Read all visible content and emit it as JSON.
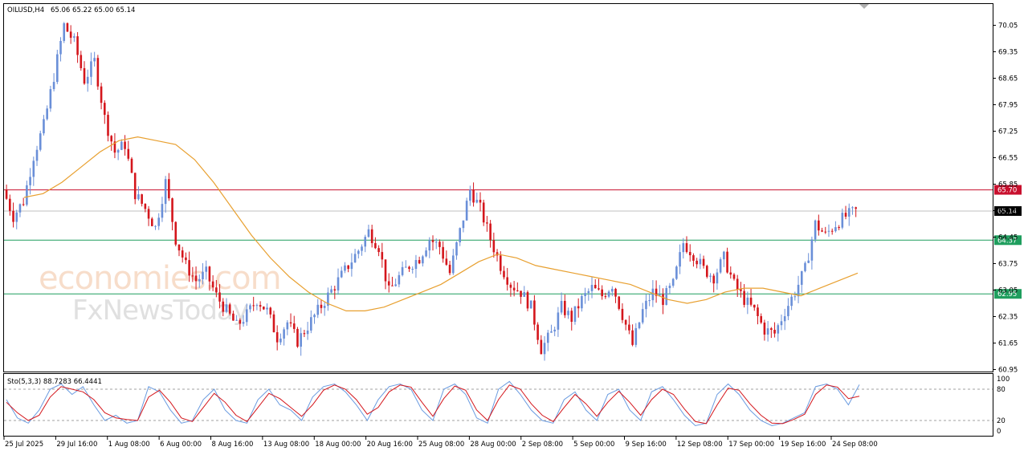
{
  "header": {
    "symbol": "OILUSD,H4",
    "ohlc": "65.06 65.22 65.00 65.14"
  },
  "stoch_header": {
    "label": "Sto(5,3,3) 88.7283 66.4441"
  },
  "watermark": {
    "line1": "economies.com",
    "line2": "FxNewsToday"
  },
  "colors": {
    "bull": "#6a8fd8",
    "bear": "#d4161c",
    "ma": "#e8a030",
    "resistance": "#c8102e",
    "support": "#1f9e5e",
    "current": "#000000",
    "stoch_main": "#6a9be0",
    "stoch_signal": "#d4161c"
  },
  "chart_data": [
    {
      "type": "candlestick",
      "symbol": "OILUSD",
      "timeframe": "H4",
      "title": "OILUSD,H4",
      "ylim": [
        60.95,
        70.4
      ],
      "y_ticks": [
        "70.05",
        "69.35",
        "68.65",
        "67.95",
        "67.25",
        "66.55",
        "65.85",
        "65.15",
        "64.45",
        "63.75",
        "63.05",
        "62.35",
        "61.65",
        "60.95"
      ],
      "x_ticks": [
        "25 Jul 2025",
        "29 Jul 16:00",
        "1 Aug 08:00",
        "6 Aug 00:00",
        "8 Aug 16:00",
        "13 Aug 08:00",
        "18 Aug 00:00",
        "20 Aug 16:00",
        "25 Aug 08:00",
        "28 Aug 00:00",
        "2 Sep 08:00",
        "5 Sep 00:00",
        "9 Sep 16:00",
        "12 Sep 08:00",
        "17 Sep 00:00",
        "19 Sep 16:00",
        "24 Sep 08:00"
      ],
      "price_path": [
        65.7,
        65.0,
        65.4,
        66.6,
        67.4,
        68.7,
        70.05,
        69.6,
        68.6,
        69.1,
        67.6,
        66.7,
        66.9,
        65.6,
        65.2,
        64.7,
        65.9,
        64.4,
        63.7,
        63.3,
        63.5,
        62.9,
        62.5,
        62.1,
        62.4,
        62.8,
        62.5,
        61.8,
        62.2,
        61.7,
        62.1,
        62.5,
        62.9,
        63.3,
        63.7,
        64.1,
        64.6,
        64.2,
        63.0,
        63.4,
        63.7,
        63.9,
        64.4,
        64.2,
        63.5,
        64.6,
        65.7,
        65.2,
        64.4,
        63.7,
        63.2,
        63.0,
        62.6,
        61.5,
        61.9,
        62.6,
        62.3,
        62.8,
        63.1,
        62.9,
        63.2,
        62.4,
        61.6,
        62.5,
        63.0,
        62.8,
        63.2,
        64.3,
        64.0,
        63.6,
        63.4,
        63.9,
        63.2,
        62.8,
        62.5,
        62.0,
        61.9,
        62.5,
        63.0,
        63.6,
        64.8,
        64.5,
        64.8,
        65.0,
        65.14
      ],
      "bearish_index": [
        1,
        6,
        8,
        10,
        12,
        15,
        17,
        20,
        22,
        25,
        26,
        28,
        36,
        37,
        42,
        43,
        46,
        47,
        48,
        49,
        50,
        51,
        52,
        55,
        60,
        61,
        64,
        67,
        68,
        69,
        71,
        72,
        73,
        74,
        75,
        80
      ],
      "series": [
        {
          "name": "",
          "kind": "moving_average",
          "values": [
            65.5,
            65.6,
            65.9,
            66.3,
            66.7,
            67.0,
            67.1,
            67.0,
            66.9,
            66.5,
            65.9,
            65.2,
            64.5,
            63.9,
            63.4,
            63.0,
            62.7,
            62.5,
            62.5,
            62.6,
            62.8,
            63.0,
            63.2,
            63.5,
            63.8,
            64.0,
            63.9,
            63.7,
            63.6,
            63.5,
            63.4,
            63.3,
            63.2,
            63.0,
            62.8,
            62.7,
            62.8,
            63.0,
            63.1,
            63.1,
            63.0,
            62.9,
            63.1,
            63.3,
            63.5
          ]
        }
      ],
      "levels": [
        {
          "label": "65.70",
          "value": 65.7,
          "kind": "resistance"
        },
        {
          "label": "65.14",
          "value": 65.14,
          "kind": "current"
        },
        {
          "label": "64.37",
          "value": 64.37,
          "kind": "support"
        },
        {
          "label": "62.95",
          "value": 62.95,
          "kind": "support"
        }
      ]
    },
    {
      "type": "line",
      "title": "Sto(5,3,3) 88.7283 66.4441",
      "ylim": [
        0,
        100
      ],
      "y_ticks": [
        "100",
        "80",
        "20",
        "0"
      ],
      "reference_lines": [
        80,
        20
      ],
      "series": [
        {
          "name": "",
          "kind": "main",
          "values": [
            60,
            25,
            15,
            40,
            80,
            90,
            70,
            85,
            50,
            20,
            30,
            15,
            20,
            85,
            75,
            40,
            15,
            20,
            60,
            80,
            40,
            20,
            15,
            60,
            80,
            50,
            40,
            20,
            65,
            85,
            90,
            75,
            50,
            20,
            60,
            85,
            90,
            80,
            40,
            20,
            80,
            90,
            70,
            25,
            15,
            80,
            95,
            70,
            40,
            20,
            15,
            60,
            75,
            40,
            20,
            70,
            80,
            40,
            20,
            75,
            85,
            60,
            30,
            10,
            15,
            70,
            90,
            70,
            40,
            20,
            10,
            15,
            25,
            35,
            85,
            90,
            80,
            50,
            88.7283
          ]
        },
        {
          "name": "",
          "kind": "signal",
          "values": [
            55,
            35,
            20,
            30,
            65,
            85,
            80,
            75,
            60,
            35,
            25,
            22,
            20,
            65,
            78,
            55,
            25,
            18,
            45,
            72,
            55,
            30,
            18,
            45,
            72,
            62,
            45,
            28,
            50,
            78,
            88,
            80,
            60,
            32,
            45,
            75,
            88,
            84,
            55,
            28,
            62,
            86,
            78,
            40,
            20,
            60,
            88,
            80,
            52,
            30,
            18,
            45,
            70,
            52,
            28,
            55,
            76,
            55,
            30,
            60,
            80,
            70,
            42,
            18,
            14,
            50,
            82,
            78,
            52,
            30,
            15,
            14,
            22,
            32,
            70,
            88,
            84,
            62,
            66.4441
          ]
        }
      ]
    }
  ]
}
